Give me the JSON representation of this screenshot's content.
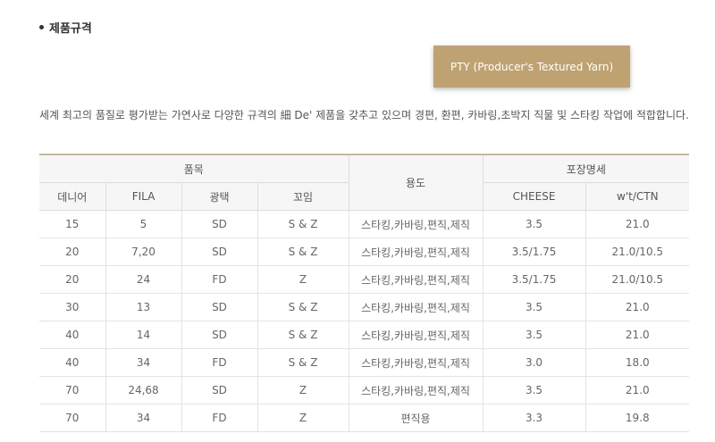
{
  "section": {
    "title": "제품규격"
  },
  "product": {
    "label": "PTY (Producer's Textured Yarn)"
  },
  "description": "세계 최고의 품질로 평가받는 가연사로 다양한 규격의 細 De' 제품을 갖추고 있으며 경편, 환편, 카바링,초박지 직물 및 스타킹 작업에 적합합니다.",
  "table": {
    "group_headers": {
      "item": "품목",
      "usage": "용도",
      "packing": "포장명세"
    },
    "sub_headers": [
      "데니어",
      "FILA",
      "광택",
      "꼬임",
      "CHEESE",
      "w't/CTN"
    ],
    "rows": [
      [
        "15",
        "5",
        "SD",
        "S & Z",
        "스타킹,카바링,편직,제직",
        "3.5",
        "21.0"
      ],
      [
        "20",
        "7,20",
        "SD",
        "S & Z",
        "스타킹,카바링,편직,제직",
        "3.5/1.75",
        "21.0/10.5"
      ],
      [
        "20",
        "24",
        "FD",
        "Z",
        "스타킹,카바링,편직,제직",
        "3.5/1.75",
        "21.0/10.5"
      ],
      [
        "30",
        "13",
        "SD",
        "S & Z",
        "스타킹,카바링,편직,제직",
        "3.5",
        "21.0"
      ],
      [
        "40",
        "14",
        "SD",
        "S & Z",
        "스타킹,카바링,편직,제직",
        "3.5",
        "21.0"
      ],
      [
        "40",
        "34",
        "FD",
        "S & Z",
        "스타킹,카바링,편직,제직",
        "3.0",
        "18.0"
      ],
      [
        "70",
        "24,68",
        "SD",
        "Z",
        "스타킹,카바링,편직,제직",
        "3.5",
        "21.0"
      ],
      [
        "70",
        "34",
        "FD",
        "Z",
        "편직용",
        "3.3",
        "19.8"
      ]
    ]
  }
}
